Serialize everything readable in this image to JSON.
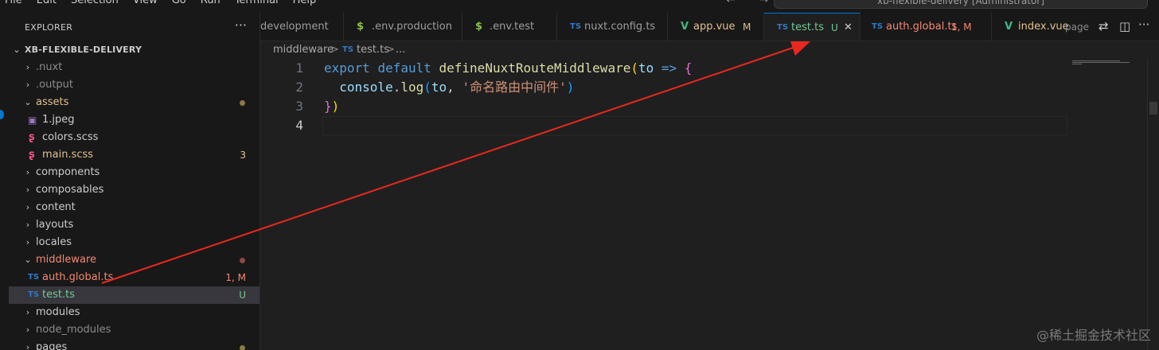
{
  "menu": [
    "File",
    "Edit",
    "Selection",
    "View",
    "Go",
    "Run",
    "Terminal",
    "Help"
  ],
  "nav": {
    "back": "←",
    "forward": "→"
  },
  "command_center": "xb-flexible-delivery [Administrator]",
  "sidebar": {
    "title": "EXPLORER",
    "more": "···",
    "root": "XB-FLEXIBLE-DELIVERY",
    "items": [
      {
        "label": ".nuxt",
        "status": ""
      },
      {
        "label": ".output",
        "status": ""
      },
      {
        "label": "assets",
        "status": ""
      },
      {
        "label": "1.jpeg",
        "status": ""
      },
      {
        "label": "colors.scss",
        "status": ""
      },
      {
        "label": "main.scss",
        "status": "3"
      },
      {
        "label": "components",
        "status": ""
      },
      {
        "label": "composables",
        "status": ""
      },
      {
        "label": "content",
        "status": ""
      },
      {
        "label": "layouts",
        "status": ""
      },
      {
        "label": "locales",
        "status": ""
      },
      {
        "label": "middleware",
        "status": ""
      },
      {
        "label": "auth.global.ts",
        "status": "1, M"
      },
      {
        "label": "test.ts",
        "status": "U"
      },
      {
        "label": "modules",
        "status": ""
      },
      {
        "label": "node_modules",
        "status": ""
      },
      {
        "label": "pages",
        "status": ""
      }
    ]
  },
  "tabs": [
    {
      "icon": "",
      "label": "development",
      "status": ""
    },
    {
      "icon": "$",
      "label": ".env.production",
      "status": ""
    },
    {
      "icon": "$",
      "label": ".env.test",
      "status": ""
    },
    {
      "icon": "TS",
      "label": "nuxt.config.ts",
      "status": ""
    },
    {
      "icon": "V",
      "label": "app.vue",
      "status": "M"
    },
    {
      "icon": "TS",
      "label": "test.ts",
      "status": "U",
      "close": "✕"
    },
    {
      "icon": "TS",
      "label": "auth.global.ts",
      "status": "1, M"
    },
    {
      "icon": "V",
      "label": "index.vue",
      "status": "",
      "desc": "page"
    }
  ],
  "tab_actions": {
    "compare": "⇄",
    "split": "◫",
    "more": "···"
  },
  "breadcrumb": {
    "folder": "middleware",
    "sep": ">",
    "file_icon": "TS",
    "file": "test.ts",
    "sep2": ">",
    "rest": "..."
  },
  "editor": {
    "line_numbers": [
      "1",
      "2",
      "3",
      "4"
    ],
    "tokens": {
      "export": "export",
      "default": "default",
      "fn": "defineNuxtRouteMiddleware",
      "lparen": "(",
      "to": "to",
      "arrow": "=>",
      "lbrace": "{",
      "console": "console",
      "dot": ".",
      "log": "log",
      "lparen2": "(",
      "to2": "to",
      "comma": ",",
      "str": "'命名路由中间件'",
      "rparen2": ")",
      "rbrace": "}",
      "rparen": ")"
    }
  },
  "watermark": "@稀土掘金技术社区",
  "colors": {
    "accent": "#0078d4",
    "arrow_annotation": "#e8281e",
    "git_modified": "#e2c08d",
    "git_untracked": "#73c991",
    "error": "#f48771"
  },
  "icons": {
    "chevron_right": "›",
    "chevron_down": "⌄",
    "ts": "TS",
    "vue": "V",
    "dollar": "$",
    "image": "▣",
    "sass": "ʂ"
  }
}
